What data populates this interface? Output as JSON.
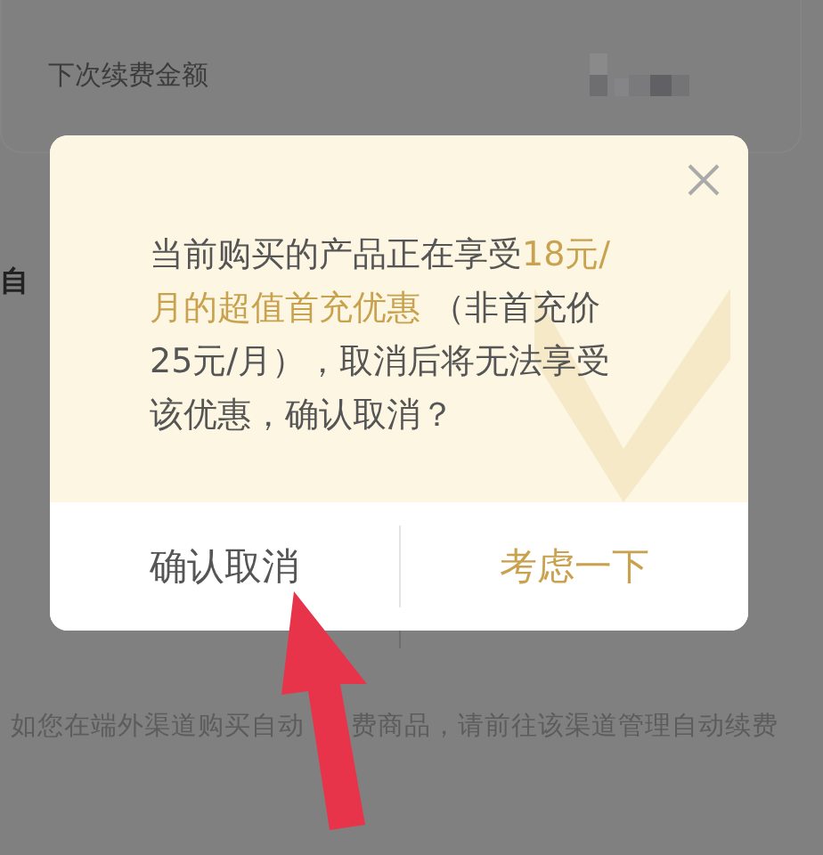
{
  "background": {
    "next_renewal_label": "下次续费金额",
    "section_label": "自",
    "footer_note": [
      "如您在端外渠道购买自动",
      "费商品，请前往该渠道管理自动续费"
    ]
  },
  "dialog": {
    "message": [
      {
        "text": "当前购买的产品正在享受",
        "highlight": false
      },
      {
        "text": "18元/月的超值首充优惠",
        "highlight": true
      },
      {
        "text": " （非首充价25元/月），取消后将无法享受该优惠，确认取消？",
        "highlight": false
      }
    ],
    "buttons": [
      {
        "label": "确认取消",
        "kind": "secondary"
      },
      {
        "label": "考虑一下",
        "kind": "primary"
      }
    ]
  }
}
